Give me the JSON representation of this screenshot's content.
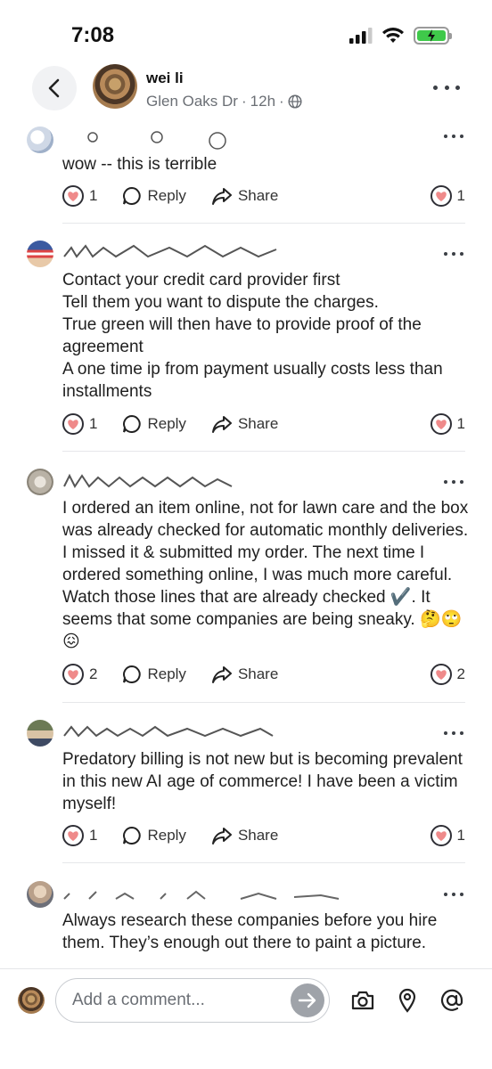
{
  "status": {
    "time": "7:08"
  },
  "post": {
    "author": "wei li",
    "location": "Glen Oaks Dr",
    "age": "12h",
    "separator": "·"
  },
  "labels": {
    "reply": "Reply",
    "share": "Share"
  },
  "comments": [
    {
      "name": "",
      "body": [
        "wow -- this is terrible"
      ],
      "reactions": "1"
    },
    {
      "name": "",
      "body": [
        "Contact your credit card provider first",
        "Tell them you want to dispute the charges.",
        "True green will then have to provide proof of the agreement",
        "A one time ip from payment usually costs less than installments"
      ],
      "reactions": "1"
    },
    {
      "name": "",
      "body": [
        "I ordered an item online, not for lawn care and the box was already checked for automatic monthly deliveries. I missed it & submitted my order. The next time I ordered something online, I was much more careful. Watch those lines that are already checked ✔️. It seems that some companies are being sneaky. 🤔🙄😖"
      ],
      "reactions": "2"
    },
    {
      "name": "",
      "body": [
        "Predatory  billing  is not new but is becoming prevalent in this new AI age of commerce! I have been a victim myself!"
      ],
      "reactions": "1"
    },
    {
      "name": "",
      "body": [
        "Always research these companies before you hire them.  They’s enough out there to paint a picture."
      ],
      "reactions": ""
    }
  ],
  "composer": {
    "placeholder": "Add a comment..."
  },
  "icons": {
    "back": "chevron-left-icon",
    "globe": "globe-icon",
    "more": "more-horizontal-icon",
    "heart": "heart-icon",
    "reply": "reply-bubble-icon",
    "share": "share-arrow-icon",
    "send": "send-arrow-icon",
    "camera": "camera-icon",
    "location": "location-pin-icon",
    "mention": "at-sign-icon"
  },
  "colors": {
    "heart": "#ef8a8a",
    "send_button": "#9fa3a9",
    "battery": "#3fc94a",
    "meta_text": "#6b6f75"
  }
}
